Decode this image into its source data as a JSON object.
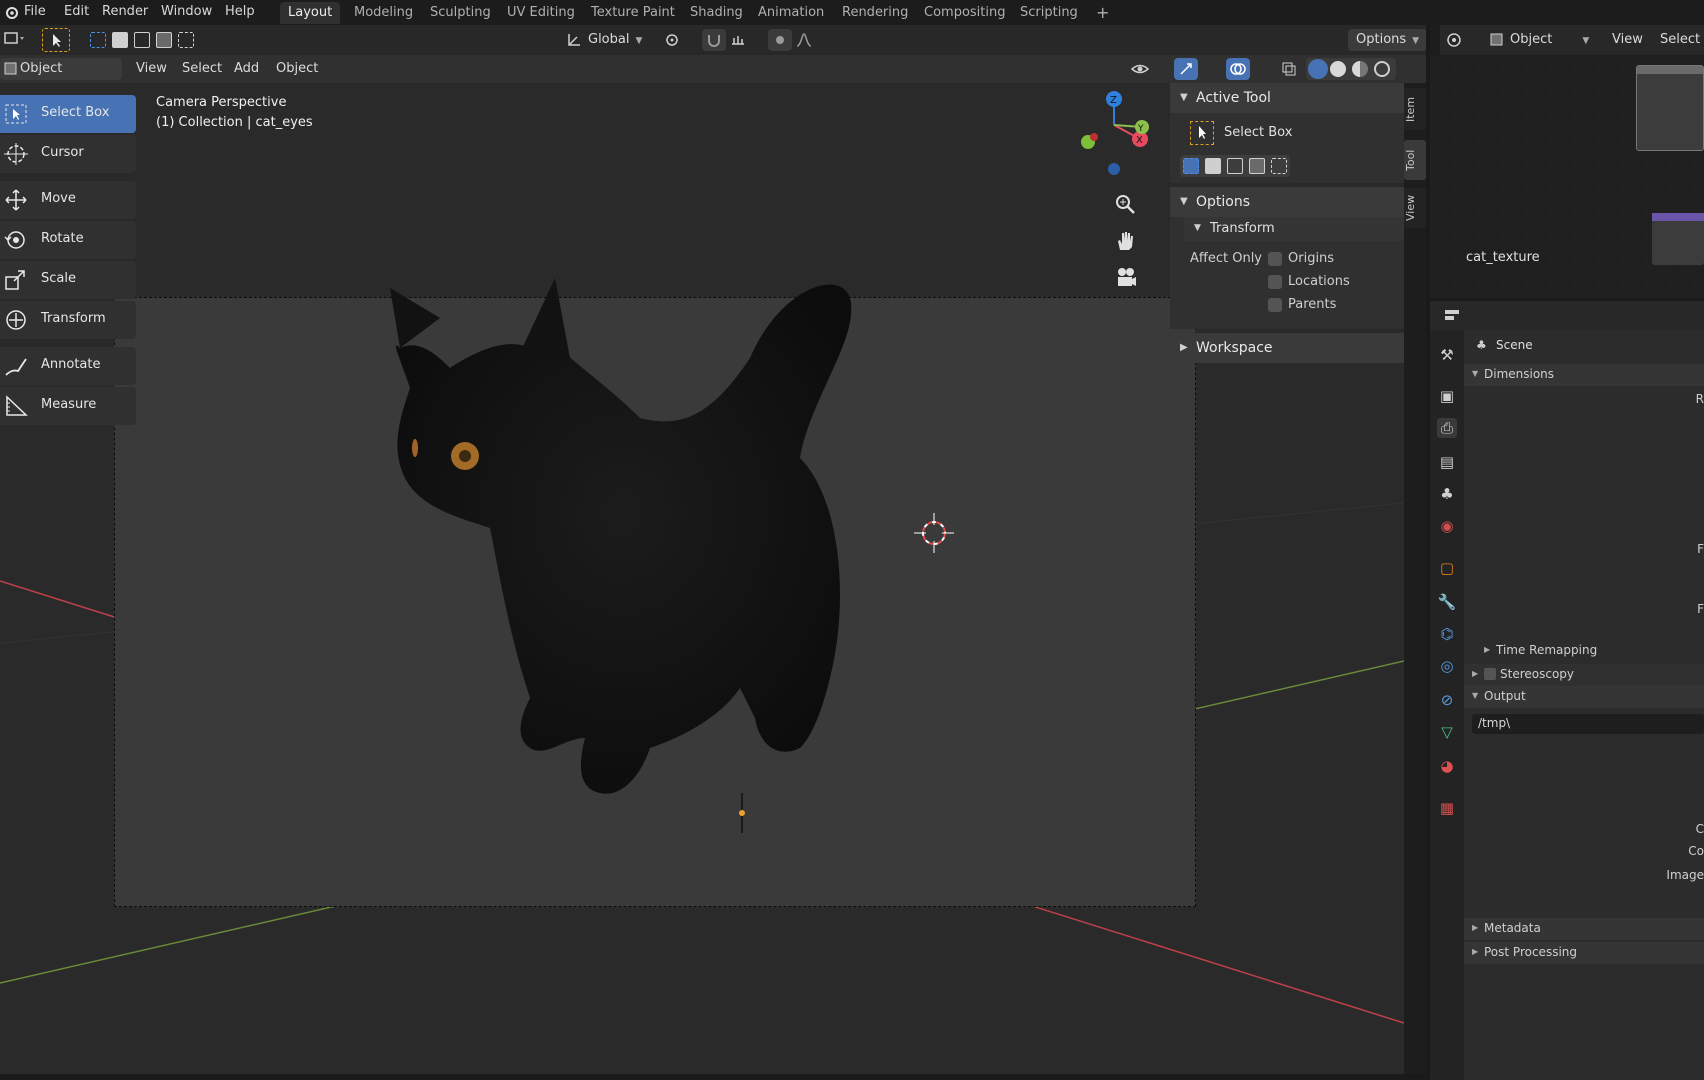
{
  "menubar": {
    "items": [
      "File",
      "Edit",
      "Render",
      "Window",
      "Help"
    ],
    "workspaces": [
      "Layout",
      "Modeling",
      "Sculpting",
      "UV Editing",
      "Texture Paint",
      "Shading",
      "Animation",
      "Rendering",
      "Compositing",
      "Scripting"
    ],
    "active_workspace": "Layout",
    "add_workspace": "+"
  },
  "header": {
    "orientation": "Global",
    "options": "Options",
    "mode": "Object Mode",
    "menus": [
      "View",
      "Select",
      "Add",
      "Object"
    ]
  },
  "viewport": {
    "label_line1": "Camera Perspective",
    "label_line2": "(1) Collection | cat_eyes",
    "gizmo": {
      "x": "X",
      "y": "Y",
      "z": "Z"
    },
    "navigation_icons": [
      "zoom-icon",
      "hand-pan-icon",
      "camera-view-icon"
    ]
  },
  "tools": [
    {
      "label": "Select Box",
      "icon": "select-box-icon",
      "active": true
    },
    {
      "label": "Cursor",
      "icon": "cursor-icon",
      "active": false
    },
    {
      "label": "Move",
      "icon": "move-icon",
      "active": false
    },
    {
      "label": "Rotate",
      "icon": "rotate-icon",
      "active": false
    },
    {
      "label": "Scale",
      "icon": "scale-icon",
      "active": false
    },
    {
      "label": "Transform",
      "icon": "transform-icon",
      "active": false
    },
    {
      "label": "Annotate",
      "icon": "annotate-icon",
      "active": false
    },
    {
      "label": "Measure",
      "icon": "measure-icon",
      "active": false
    }
  ],
  "npanel": {
    "active_tool_title": "Active Tool",
    "active_tool_name": "Select Box",
    "options_title": "Options",
    "transform_title": "Transform",
    "affect_only": "Affect Only",
    "checkboxes": [
      {
        "label": "Origins",
        "checked": false
      },
      {
        "label": "Locations",
        "checked": false
      },
      {
        "label": "Parents",
        "checked": false
      }
    ],
    "workspace_title": "Workspace",
    "tabs": [
      "Item",
      "Tool",
      "View"
    ],
    "active_tab": "Tool"
  },
  "node_editor": {
    "object_selector": "Object",
    "menus": [
      "View",
      "Select"
    ],
    "node_label": "cat_texture"
  },
  "properties": {
    "scene_label": "Scene",
    "sections": {
      "dimensions": "Dimensions",
      "time_remapping": "Time Remapping",
      "stereoscopy": "Stereoscopy",
      "output": "Output",
      "metadata": "Metadata",
      "post_processing": "Post Processing"
    },
    "output_path": "/tmp\\",
    "cut_labels": [
      "R",
      "F",
      "F",
      "C",
      "Co",
      "Image"
    ]
  },
  "colors": {
    "accent": "#4772b3",
    "x_axis": "#e84a5f",
    "y_axis": "#8cc04a",
    "z_axis": "#2f7fdc"
  }
}
